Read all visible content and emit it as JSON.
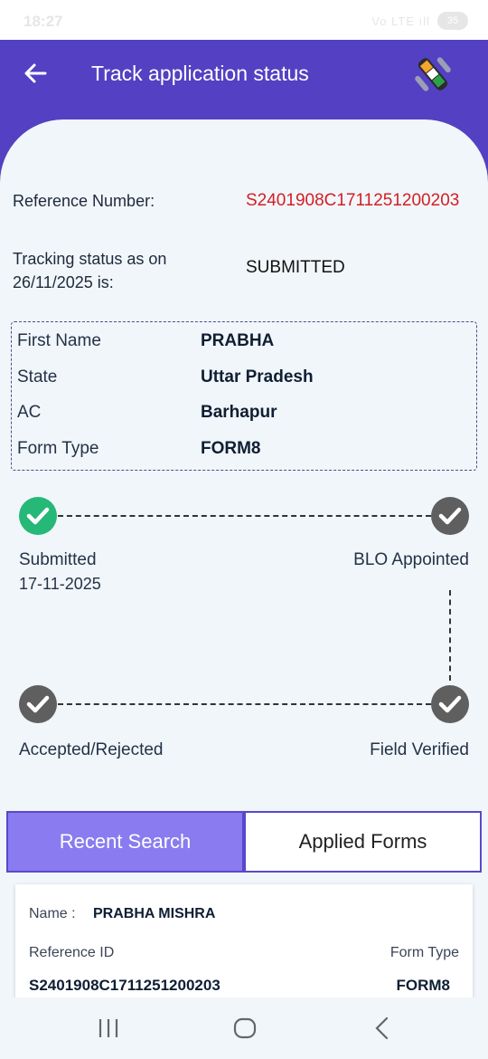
{
  "status_bar": {
    "time": "18:27",
    "signal": "Vo LTE ıll",
    "battery": "35"
  },
  "header": {
    "title": "Track application status"
  },
  "reference": {
    "label": "Reference Number:",
    "value": "S2401908C1711251200203"
  },
  "tracking": {
    "label_line1": "Tracking status as on",
    "label_line2": "26/11/2025 is:",
    "value": "SUBMITTED"
  },
  "details": [
    {
      "label": "First Name",
      "value": "PRABHA"
    },
    {
      "label": "State",
      "value": "Uttar Pradesh"
    },
    {
      "label": "AC",
      "value": "Barhapur"
    },
    {
      "label": "Form Type",
      "value": "FORM8"
    }
  ],
  "timeline": {
    "submitted": {
      "label": "Submitted",
      "date": "17-11-2025",
      "status": "done"
    },
    "blo_appointed": {
      "label": "BLO Appointed",
      "status": "pending"
    },
    "field_verified": {
      "label": "Field Verified",
      "status": "pending"
    },
    "accepted_rejected": {
      "label": "Accepted/Rejected",
      "status": "pending"
    }
  },
  "tabs": {
    "recent": "Recent Search",
    "applied": "Applied Forms",
    "active": "recent"
  },
  "recent_card": {
    "name_label": "Name :",
    "name_value": "PRABHA MISHRA",
    "ref_label": "Reference ID",
    "ref_value": "S2401908C1711251200203",
    "form_label": "Form Type",
    "form_value": "FORM8"
  },
  "colors": {
    "header": "#5440c2",
    "reference_value": "#d11f25",
    "step_done": "#25b877",
    "step_pending": "#5f5f5f",
    "tab_active": "#8a7bf0"
  },
  "icons": {
    "back": "arrow-left-icon",
    "logo": "evm-finger-ink-logo",
    "recents": "recent-apps-icon",
    "home": "home-icon",
    "back_nav": "chevron-left-icon"
  }
}
